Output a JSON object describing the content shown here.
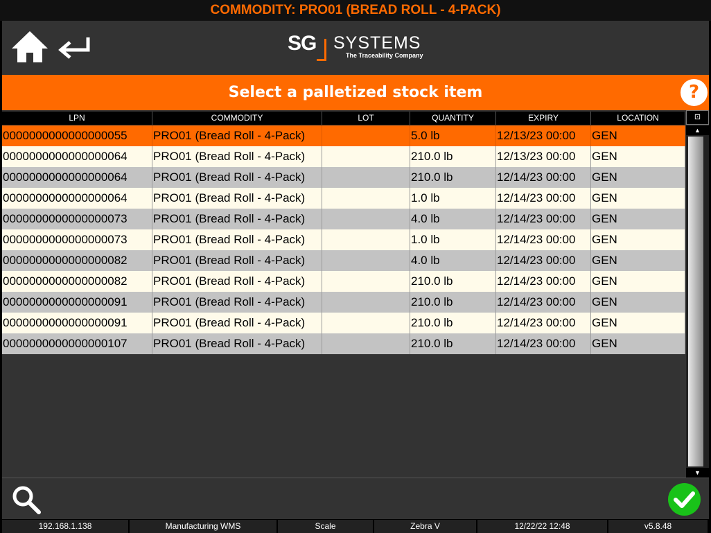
{
  "title": "COMMODITY: PRO01 (BREAD ROLL - 4-PACK)",
  "logo": {
    "brand_sg": "SG",
    "brand_systems": "SYSTEMS",
    "tagline": "The Traceability Company"
  },
  "banner": {
    "text": "Select a palletized stock item",
    "help_label": "?"
  },
  "table": {
    "columns": [
      "LPN",
      "COMMODITY",
      "LOT",
      "QUANTITY",
      "EXPIRY",
      "LOCATION"
    ],
    "rows": [
      {
        "lpn": "0000000000000000055",
        "commodity": "PRO01 (Bread Roll - 4-Pack)",
        "lot": "",
        "quantity": "5.0 lb",
        "expiry": "12/13/23 00:00",
        "location": "GEN",
        "selected": true
      },
      {
        "lpn": "0000000000000000064",
        "commodity": "PRO01 (Bread Roll - 4-Pack)",
        "lot": "",
        "quantity": "210.0 lb",
        "expiry": "12/13/23 00:00",
        "location": "GEN"
      },
      {
        "lpn": "0000000000000000064",
        "commodity": "PRO01 (Bread Roll - 4-Pack)",
        "lot": "",
        "quantity": "210.0 lb",
        "expiry": "12/14/23 00:00",
        "location": "GEN"
      },
      {
        "lpn": "0000000000000000064",
        "commodity": "PRO01 (Bread Roll - 4-Pack)",
        "lot": "",
        "quantity": "1.0 lb",
        "expiry": "12/14/23 00:00",
        "location": "GEN"
      },
      {
        "lpn": "0000000000000000073",
        "commodity": "PRO01 (Bread Roll - 4-Pack)",
        "lot": "",
        "quantity": "4.0 lb",
        "expiry": "12/14/23 00:00",
        "location": "GEN"
      },
      {
        "lpn": "0000000000000000073",
        "commodity": "PRO01 (Bread Roll - 4-Pack)",
        "lot": "",
        "quantity": "1.0 lb",
        "expiry": "12/14/23 00:00",
        "location": "GEN"
      },
      {
        "lpn": "0000000000000000082",
        "commodity": "PRO01 (Bread Roll - 4-Pack)",
        "lot": "",
        "quantity": "4.0 lb",
        "expiry": "12/14/23 00:00",
        "location": "GEN"
      },
      {
        "lpn": "0000000000000000082",
        "commodity": "PRO01 (Bread Roll - 4-Pack)",
        "lot": "",
        "quantity": "210.0 lb",
        "expiry": "12/14/23 00:00",
        "location": "GEN"
      },
      {
        "lpn": "0000000000000000091",
        "commodity": "PRO01 (Bread Roll - 4-Pack)",
        "lot": "",
        "quantity": "210.0 lb",
        "expiry": "12/14/23 00:00",
        "location": "GEN"
      },
      {
        "lpn": "0000000000000000091",
        "commodity": "PRO01 (Bread Roll - 4-Pack)",
        "lot": "",
        "quantity": "210.0 lb",
        "expiry": "12/14/23 00:00",
        "location": "GEN"
      },
      {
        "lpn": "0000000000000000107",
        "commodity": "PRO01 (Bread Roll - 4-Pack)",
        "lot": "",
        "quantity": "210.0 lb",
        "expiry": "12/14/23 00:00",
        "location": "GEN"
      }
    ]
  },
  "icons": {
    "header": [
      "home-icon",
      "back-arrow-icon"
    ],
    "banner": [
      "help-icon"
    ],
    "table": [
      "column-chooser-icon",
      "scroll-up-icon",
      "scroll-down-icon"
    ],
    "footer": [
      "search-icon",
      "checkmark-icon"
    ]
  },
  "statusbar": [
    "192.168.1.138",
    "Manufacturing WMS",
    "Scale",
    "Zebra V",
    "12/22/22 12:48",
    "v5.8.48"
  ],
  "colors": {
    "accent": "#ff6a00",
    "row_even": "#fffbea",
    "row_odd": "#c3c3c3",
    "confirm": "#19c219",
    "panel": "#333333"
  }
}
